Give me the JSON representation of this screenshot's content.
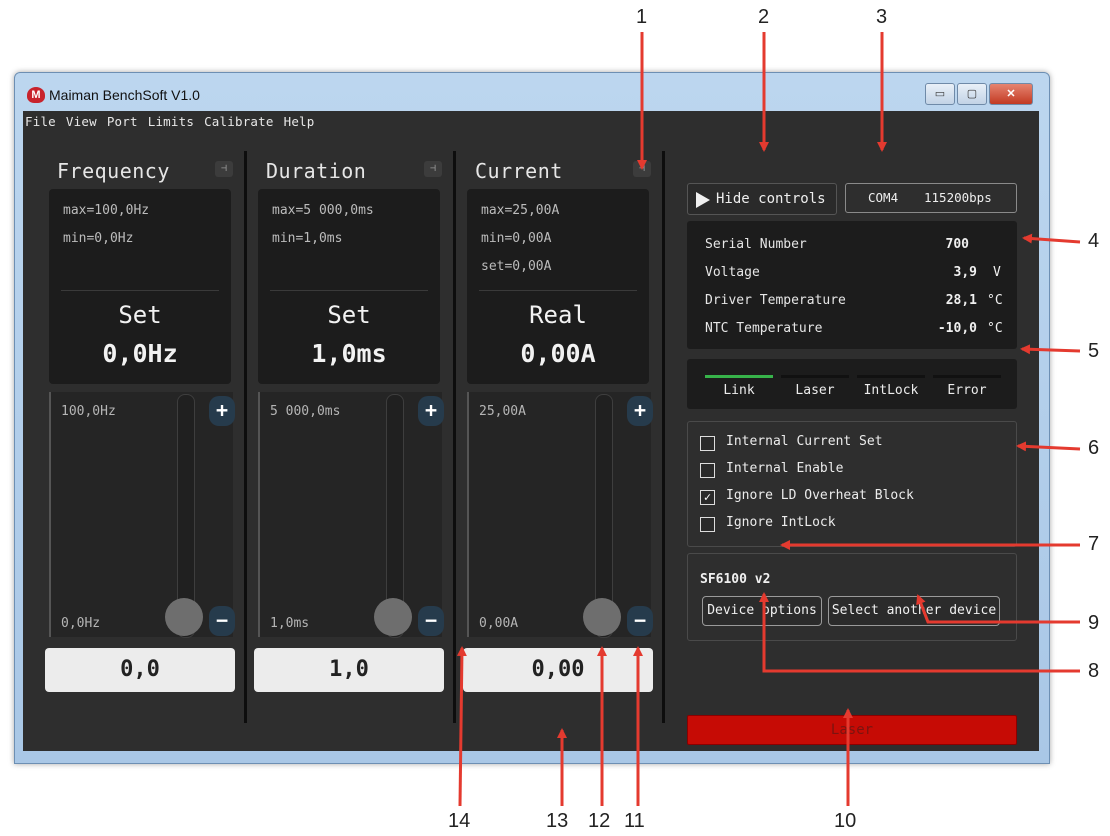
{
  "window": {
    "title": "Maiman BenchSoft V1.0",
    "logo_text": "M",
    "controls": {
      "minimize": "▭",
      "maximize": "▢",
      "close": "✕"
    }
  },
  "menu": [
    "File",
    "View",
    "Port",
    "Limits",
    "Calibrate",
    "Help"
  ],
  "columns": [
    {
      "title": "Frequency",
      "lines": [
        "max=100,0Hz",
        "min=0,0Hz"
      ],
      "mode": "Set",
      "value": "0,0Hz",
      "range_max": "100,0Hz",
      "range_min": "0,0Hz",
      "input": "0,0"
    },
    {
      "title": "Duration",
      "lines": [
        "max=5 000,0ms",
        "min=1,0ms"
      ],
      "mode": "Set",
      "value": "1,0ms",
      "range_max": "5 000,0ms",
      "range_min": "1,0ms",
      "input": "1,0"
    },
    {
      "title": "Current",
      "lines": [
        "max=25,00A",
        "min=0,00A",
        "set=0,00A"
      ],
      "mode": "Real",
      "value": "0,00A",
      "range_max": "25,00A",
      "range_min": "0,00A",
      "input": "0,00"
    }
  ],
  "pin_glyph": "⊣",
  "plus": "+",
  "minus": "−",
  "hide_controls": "Hide controls",
  "com": {
    "port": "COM4",
    "baud": "115200bps"
  },
  "status": {
    "serial_label": "Serial Number",
    "serial_value": "700",
    "voltage_label": "Voltage",
    "voltage_value": "3,9",
    "voltage_unit": "V",
    "driver_temp_label": "Driver Temperature",
    "driver_temp_value": "28,1",
    "driver_temp_unit": "°C",
    "ntc_temp_label": "NTC Temperature",
    "ntc_temp_value": "-10,0",
    "ntc_temp_unit": "°C"
  },
  "indicators": [
    "Link",
    "Laser",
    "IntLock",
    "Error"
  ],
  "indicator_active_color": "#37b34a",
  "options": [
    {
      "label": "Internal Current Set",
      "checked": "",
      "state": false
    },
    {
      "label": "Internal Enable",
      "checked": "",
      "state": false
    },
    {
      "label": "Ignore LD Overheat Block",
      "checked": "✓",
      "state": true
    },
    {
      "label": "Ignore IntLock",
      "checked": "",
      "state": false
    }
  ],
  "device": {
    "name": "SF6100 v2",
    "options_button": "Device options",
    "select_button": "Select another device"
  },
  "laser_button": "Laser",
  "laser_color": "#c60b05",
  "callouts": [
    "1",
    "2",
    "3",
    "4",
    "5",
    "6",
    "7",
    "8",
    "9",
    "10",
    "11",
    "12",
    "13",
    "14"
  ]
}
